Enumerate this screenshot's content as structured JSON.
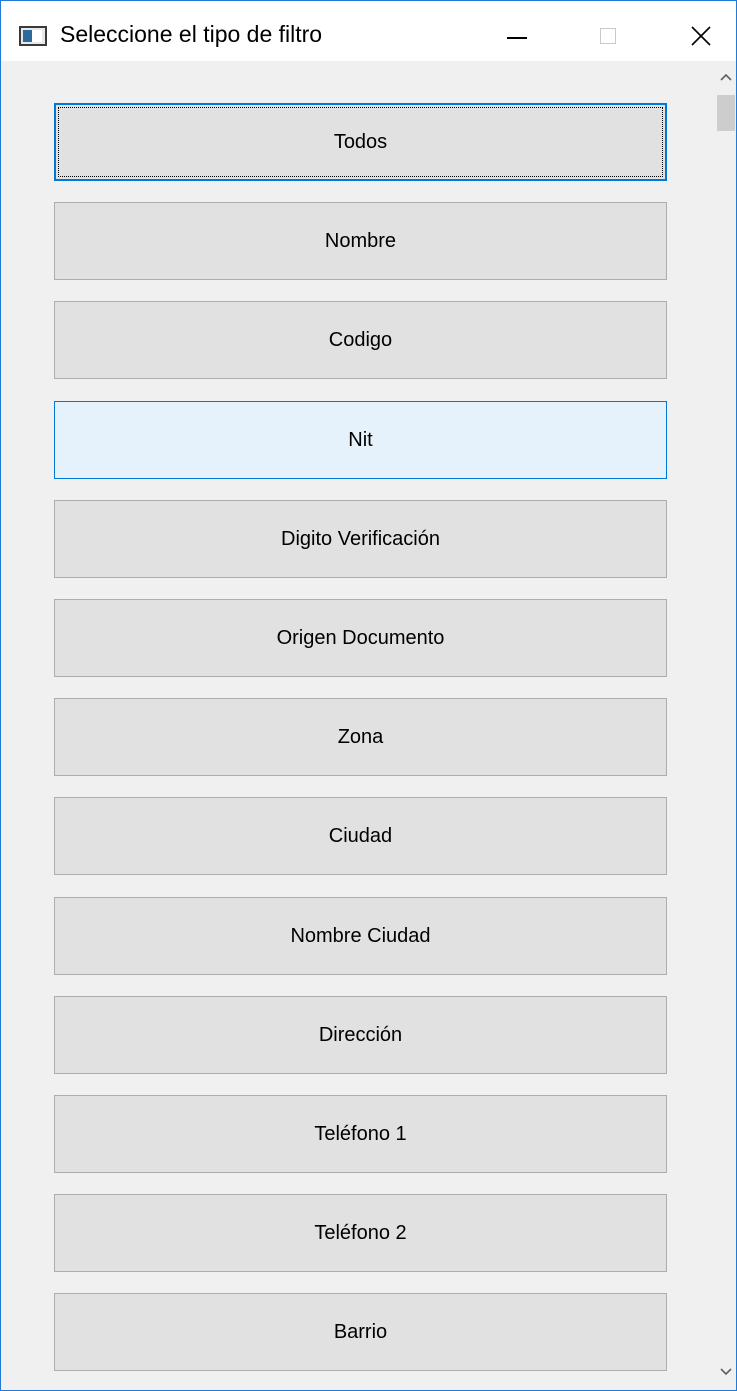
{
  "window": {
    "title": "Seleccione el tipo de filtro",
    "icon": "window-app-icon"
  },
  "titlebar_buttons": {
    "minimize_icon": "minimize-icon",
    "maximize_icon": "maximize-icon",
    "close_icon": "close-icon"
  },
  "filters": [
    {
      "label": "Todos",
      "state": "focused"
    },
    {
      "label": "Nombre",
      "state": "normal"
    },
    {
      "label": "Codigo",
      "state": "normal"
    },
    {
      "label": "Nit",
      "state": "hover"
    },
    {
      "label": "Digito Verificación",
      "state": "normal"
    },
    {
      "label": "Origen Documento",
      "state": "normal"
    },
    {
      "label": "Zona",
      "state": "normal"
    },
    {
      "label": "Ciudad",
      "state": "normal"
    },
    {
      "label": "Nombre Ciudad",
      "state": "normal"
    },
    {
      "label": "Dirección",
      "state": "normal"
    },
    {
      "label": "Teléfono 1",
      "state": "normal"
    },
    {
      "label": "Teléfono 2",
      "state": "normal"
    },
    {
      "label": "Barrio",
      "state": "normal"
    }
  ],
  "colors": {
    "accent": "#0078d7",
    "button_bg": "#e1e1e1",
    "hover_bg": "#e5f1fb",
    "window_bg": "#f0f0f0"
  }
}
